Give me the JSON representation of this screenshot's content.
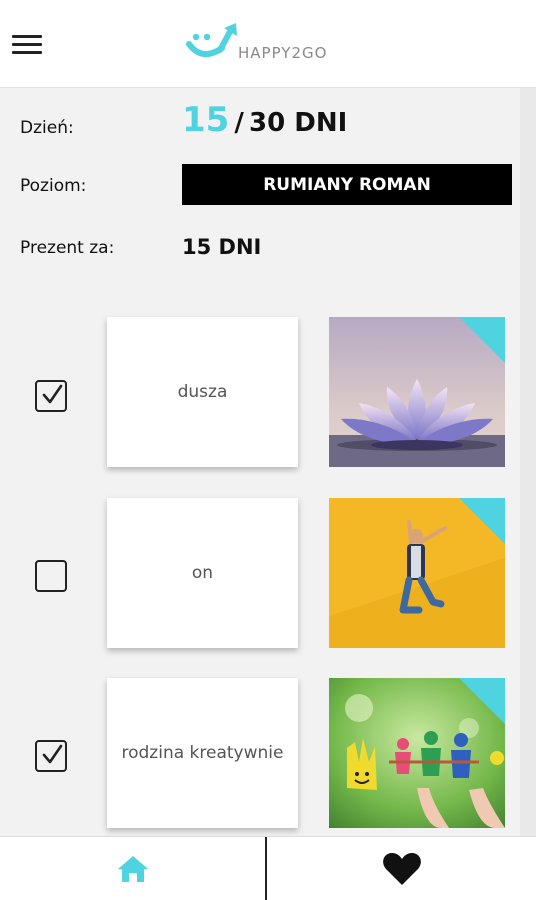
{
  "app": {
    "logo_text": "HAPPY2GO",
    "accent_color": "#4fd3e0"
  },
  "header": {
    "menu_icon": "hamburger-menu-icon"
  },
  "summary": {
    "day_label": "Dzień:",
    "day_current": "15",
    "day_separator": "/",
    "day_total": "30 DNI",
    "level_label": "Poziom:",
    "level_value": "RUMIANY ROMAN",
    "gift_label": "Prezent za:",
    "gift_value": "15 DNI"
  },
  "tasks": [
    {
      "label": "dusza",
      "checked": true,
      "image": "lotus-flower-photo"
    },
    {
      "label": "on",
      "checked": false,
      "image": "jumping-man-photo"
    },
    {
      "label": "rodzina kreatywnie",
      "checked": true,
      "image": "painted-hands-family-photo"
    }
  ],
  "bottom_nav": {
    "home_icon": "home-icon",
    "favorites_icon": "heart-icon"
  }
}
